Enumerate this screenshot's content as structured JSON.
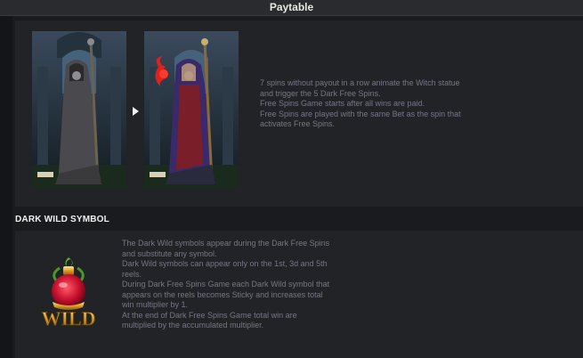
{
  "header": {
    "title": "Paytable"
  },
  "free_spins": {
    "lines": [
      "7 spins without payout in a row animate the Witch statue",
      "and trigger the 5 Dark Free Spins.",
      "Free Spins Game starts after all wins are paid.",
      "Free Spins are played with the same Bet as the spin that",
      "activates Free Spins."
    ],
    "images": [
      "witch-statue-image",
      "witch-animated-image"
    ],
    "arrow_icon": "triangle-right-icon"
  },
  "dark_wild": {
    "heading": "DARK WILD SYMBOL",
    "symbol_text": "WILD",
    "lines": [
      "The Dark Wild symbols appear during the Dark Free Spins",
      "and substitute any symbol.",
      "Dark Wild symbols can appear only on the 1st, 3d and 5th",
      "reels.",
      "During Dark Free Spins Game each Dark Wild symbol that",
      "appears on the reels becomes Sticky and increases total",
      "win multiplier by 1.",
      "At the end of Dark Free Spins Game total win are",
      "multiplied by the accumulated multiplier."
    ]
  },
  "colors": {
    "background": "#1a1b1f",
    "panel": "#222327",
    "text_muted": "#747884",
    "heading": "#f0f0f0",
    "wild_gold": "#d8a028",
    "potion_red": "#c8102e"
  }
}
